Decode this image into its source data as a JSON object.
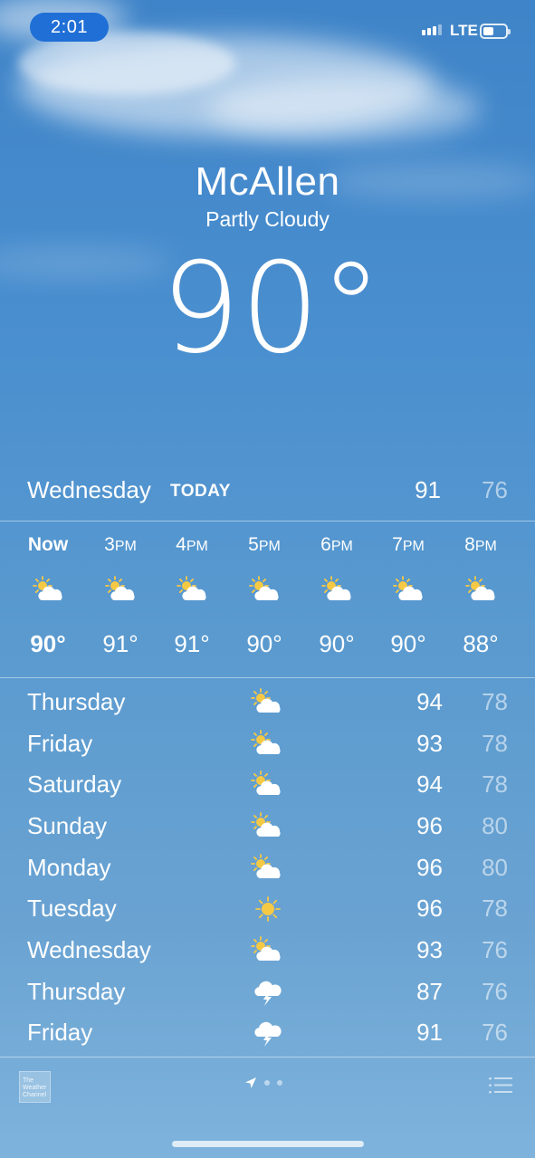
{
  "status_bar": {
    "time": "2:01",
    "network": "LTE"
  },
  "location": {
    "city": "McAllen",
    "condition": "Partly Cloudy",
    "temperature": "90°"
  },
  "today": {
    "day": "Wednesday",
    "tag": "TODAY",
    "high": "91",
    "low": "76"
  },
  "hourly": [
    {
      "time": "Now",
      "icon": "partly-cloudy-icon",
      "temp": "90°"
    },
    {
      "time": "3PM",
      "icon": "partly-cloudy-icon",
      "temp": "91°"
    },
    {
      "time": "4PM",
      "icon": "partly-cloudy-icon",
      "temp": "91°"
    },
    {
      "time": "5PM",
      "icon": "partly-cloudy-icon",
      "temp": "90°"
    },
    {
      "time": "6PM",
      "icon": "partly-cloudy-icon",
      "temp": "90°"
    },
    {
      "time": "7PM",
      "icon": "partly-cloudy-icon",
      "temp": "90°"
    },
    {
      "time": "8PM",
      "icon": "partly-cloudy-icon",
      "temp": "88°"
    }
  ],
  "daily": [
    {
      "day": "Thursday",
      "icon": "partly-cloudy-icon",
      "high": "94",
      "low": "78"
    },
    {
      "day": "Friday",
      "icon": "partly-cloudy-icon",
      "high": "93",
      "low": "78"
    },
    {
      "day": "Saturday",
      "icon": "partly-cloudy-icon",
      "high": "94",
      "low": "78"
    },
    {
      "day": "Sunday",
      "icon": "partly-cloudy-icon",
      "high": "96",
      "low": "80"
    },
    {
      "day": "Monday",
      "icon": "partly-cloudy-icon",
      "high": "96",
      "low": "80"
    },
    {
      "day": "Tuesday",
      "icon": "sunny-icon",
      "high": "96",
      "low": "78"
    },
    {
      "day": "Wednesday",
      "icon": "partly-cloudy-icon",
      "high": "93",
      "low": "76"
    },
    {
      "day": "Thursday",
      "icon": "thunderstorm-icon",
      "high": "87",
      "low": "76"
    },
    {
      "day": "Friday",
      "icon": "thunderstorm-icon",
      "high": "91",
      "low": "76"
    }
  ],
  "footer": {
    "provider_logo": "The Weather Channel"
  },
  "colors": {
    "time_pill": "#1f6fd6",
    "sun": "#f6c945"
  }
}
